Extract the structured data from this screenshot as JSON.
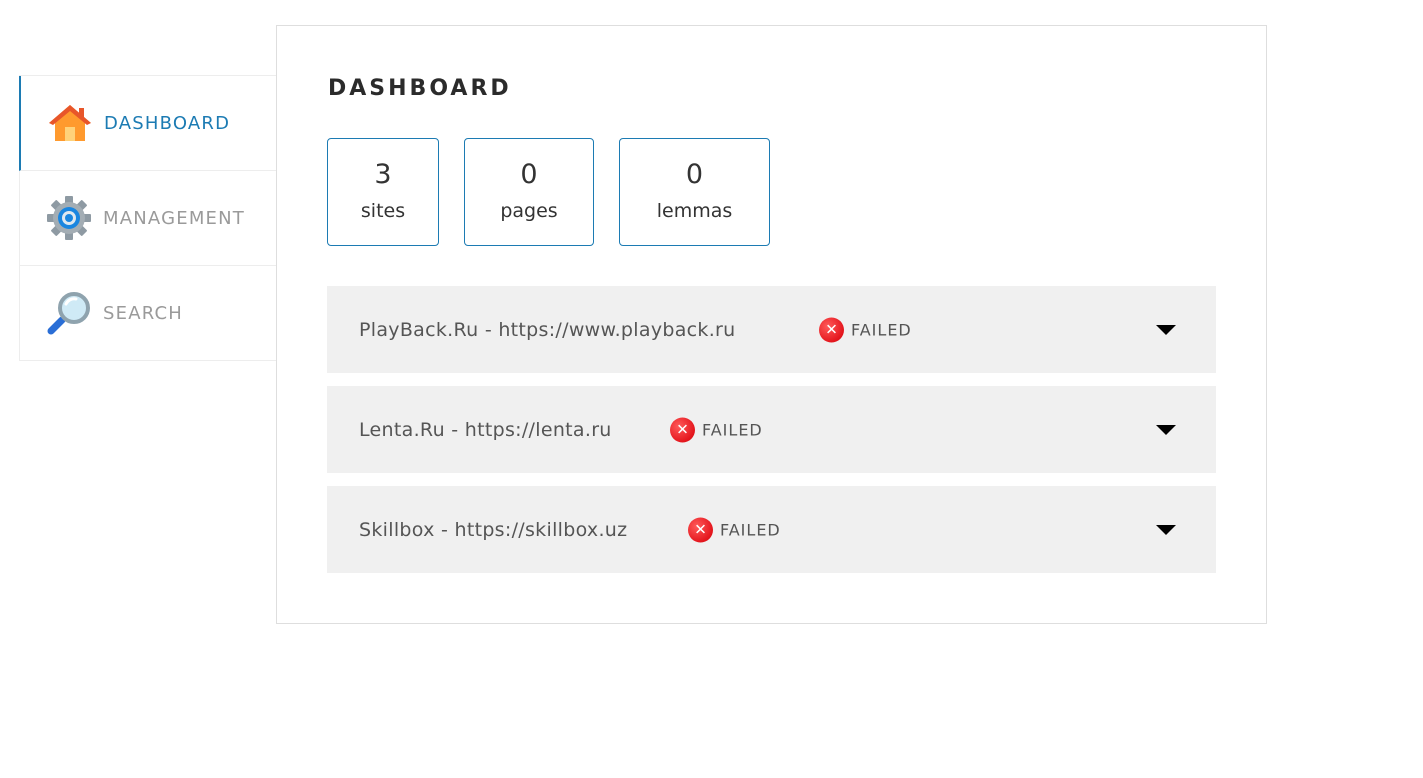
{
  "nav": {
    "items": [
      {
        "label": "DASHBOARD",
        "icon": "home-icon",
        "active": true
      },
      {
        "label": "MANAGEMENT",
        "icon": "gear-icon",
        "active": false
      },
      {
        "label": "SEARCH",
        "icon": "magnifier-icon",
        "active": false
      }
    ]
  },
  "dashboard": {
    "title": "DASHBOARD",
    "stats": [
      {
        "value": "3",
        "label": "sites"
      },
      {
        "value": "0",
        "label": "pages"
      },
      {
        "value": "0",
        "label": "lemmas"
      }
    ],
    "sites": [
      {
        "name": "PlayBack.Ru - https://www.playback.ru",
        "status": "FAILED"
      },
      {
        "name": "Lenta.Ru - https://lenta.ru",
        "status": "FAILED"
      },
      {
        "name": "Skillbox - https://skillbox.uz",
        "status": "FAILED"
      }
    ]
  },
  "colors": {
    "accent": "#1c7bb3",
    "failed": "#e4161d",
    "row_background": "#f0f0f0"
  }
}
